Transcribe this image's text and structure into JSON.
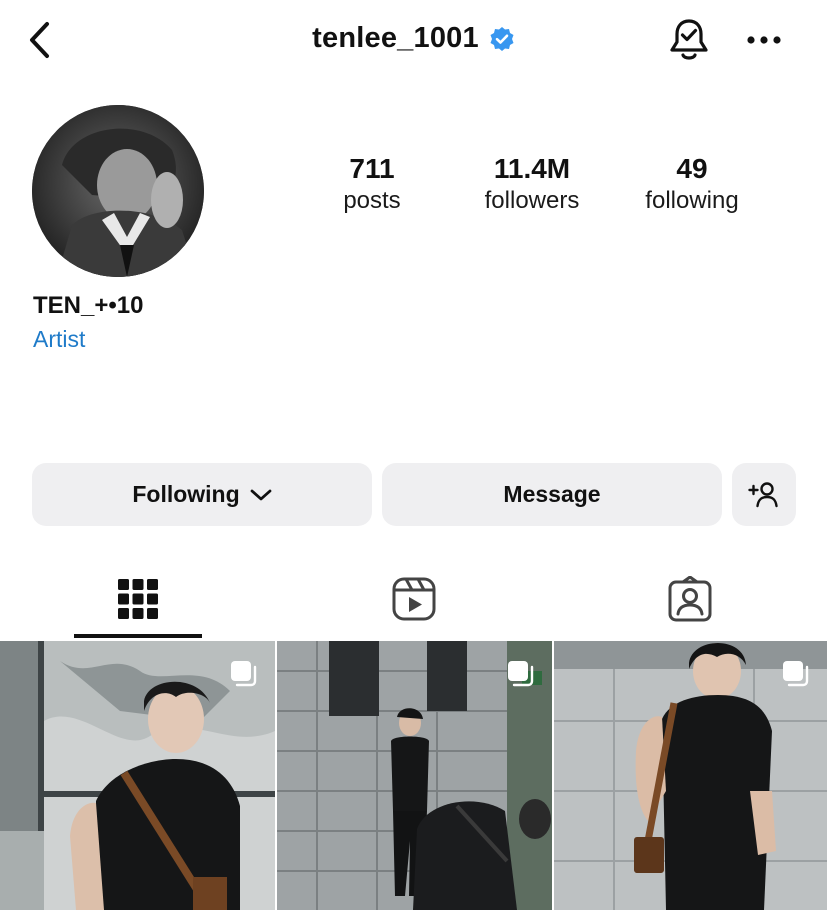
{
  "header": {
    "username": "tenlee_1001",
    "verified": true,
    "icons": {
      "back": "chevron-left-icon",
      "verified": "verified-badge-icon",
      "notifications": "bell-check-icon",
      "more": "more-horizontal-icon"
    }
  },
  "profile": {
    "display_name": "TEN_+•10",
    "category": "Artist",
    "stats": [
      {
        "value": "711",
        "label": "posts"
      },
      {
        "value": "11.4M",
        "label": "followers"
      },
      {
        "value": "49",
        "label": "following"
      }
    ]
  },
  "actions": {
    "following_label": "Following",
    "message_label": "Message",
    "icons": {
      "following_dropdown": "chevron-down-icon",
      "suggest": "add-person-icon"
    }
  },
  "tabs": [
    {
      "name": "posts-grid",
      "icon": "grid-icon",
      "active": true
    },
    {
      "name": "reels",
      "icon": "reels-icon",
      "active": false
    },
    {
      "name": "tagged",
      "icon": "tagged-person-icon",
      "active": false
    }
  ],
  "colors": {
    "accent_link": "#1f7bc9",
    "verified_blue": "#3897f0",
    "button_bg": "#efeff1",
    "text": "#111111"
  }
}
